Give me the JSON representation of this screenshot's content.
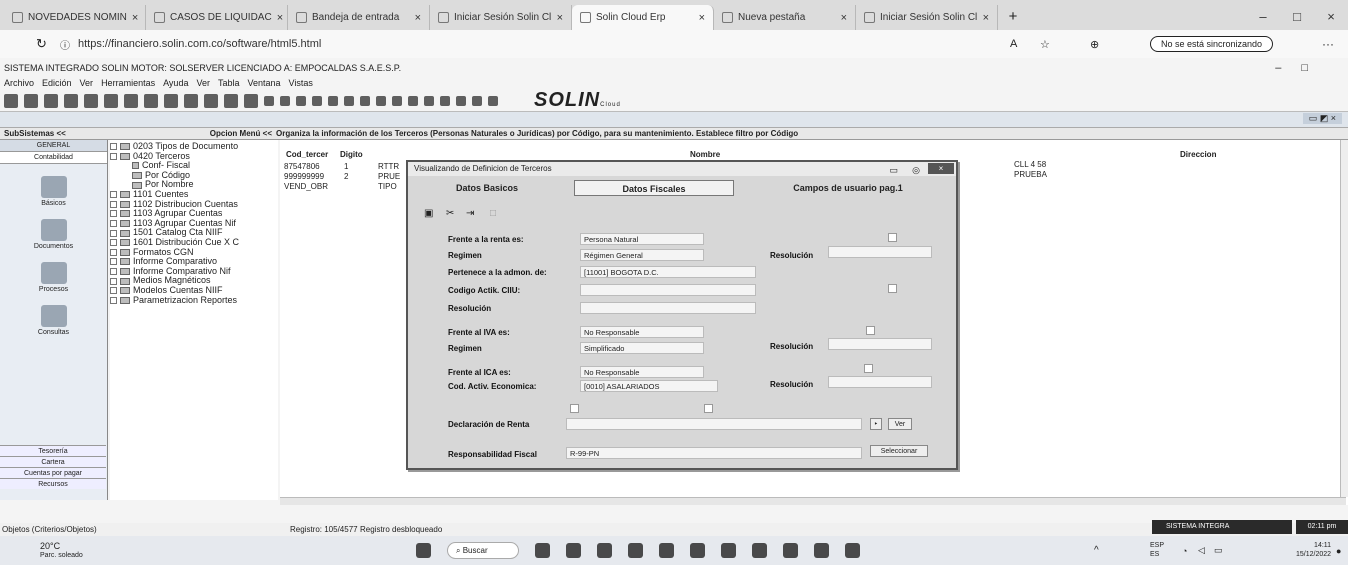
{
  "browser": {
    "tabs": [
      {
        "label": "NOVEDADES NOMIN"
      },
      {
        "label": "CASOS DE LIQUIDAC"
      },
      {
        "label": "Bandeja de entrada"
      },
      {
        "label": "Iniciar Sesión Solin Cl"
      },
      {
        "label": "Solin Cloud Erp"
      },
      {
        "label": "Nueva pestaña"
      },
      {
        "label": "Iniciar Sesión Solin Cl"
      }
    ],
    "url": "https://financiero.solin.com.co/software/html5.html",
    "sync_label": "No se está sincronizando"
  },
  "app": {
    "title": "SISTEMA INTEGRADO SOLIN MOTOR: SOLSERVER LICENCIADO A: EMPOCALDAS S.A.E.S.P.",
    "menu": [
      "Archivo",
      "Edición",
      "Ver",
      "Herramientas",
      "Ayuda",
      "Ver",
      "Tabla",
      "Ventana",
      "Vistas"
    ],
    "brand": "SOLIN",
    "brand_sub": "Cloud"
  },
  "header_row": {
    "subsistemas": "SubSistemas <<",
    "opcion_menu": "Opcion Menú <<",
    "info": "Organiza la información de los Terceros (Personas Naturales o Jurídicas) por Código, para su mantenimiento. Establece filtro por Código"
  },
  "sidebar": {
    "top_tabs": [
      "GENERAL",
      "Contabilidad"
    ],
    "items": [
      "Básicos",
      "Documentos",
      "Procesos",
      "Consultas"
    ],
    "bottom_tabs": [
      "Tesorería",
      "Cartera",
      "Cuentas por pagar",
      "Recursos"
    ]
  },
  "tree": {
    "items": [
      "0203 Tipos de Documento",
      "0420 Terceros",
      "Conf- Fiscal",
      "Por Código",
      "Por Nombre",
      "1101 Cuentes",
      "1102 Distribucion Cuentas",
      "1103 Agrupar Cuentas",
      "1103 Agrupar Cuentas Nif",
      "1501 Catalog Cta NIIF",
      "1601 Distribución Cue X C",
      "Formatos CGN",
      "Informe Comparativo",
      "Informe Comparativo Nif",
      "Medios Magnéticos",
      "Modelos Cuentas NIIF",
      "Parametrizacion Reportes"
    ]
  },
  "grid": {
    "headers": {
      "cod": "Cod_tercer",
      "digito": "Digito",
      "nombre": "Nombre",
      "direccion": "Direccion"
    },
    "rows": [
      {
        "cod": "87547806",
        "dig": "1",
        "nom": "RTTR",
        "dir": "CLL 4 58"
      },
      {
        "cod": "999999999",
        "dig": "2",
        "nom": "PRUE",
        "dir": "PRUEBA"
      },
      {
        "cod": "VEND_OBR",
        "dig": "",
        "nom": "TIPO",
        "dir": ""
      }
    ]
  },
  "dialog": {
    "title": "Visualizando de Definicion de Terceros",
    "tabs": [
      "Datos Basicos",
      "Datos Fiscales",
      "Campos de usuario pag.1"
    ],
    "fields": {
      "renta_label": "Frente a la renta es:",
      "renta_value": "Persona Natural",
      "regimen_label": "Regimen",
      "regimen_value": "Régimen General",
      "resolucion1": "Resolución",
      "pertenece_label": "Pertenece a la admon. de:",
      "pertenece_value": "[11001] BOGOTA D.C.",
      "codigo_ciiu_label": "Codigo Actik. CIIU:",
      "resolucion_label": "Resolución",
      "iva_label": "Frente al IVA es:",
      "iva_value": "No Responsable",
      "regimen2_label": "Regimen",
      "regimen2_value": "Simplificado",
      "resolucion2": "Resolución",
      "ica_label": "Frente al ICA es:",
      "ica_value": "No Responsable",
      "cod_econ_label": "Cod. Activ. Economica:",
      "cod_econ_value": "[0010] ASALARIADOS",
      "resolucion3": "Resolución",
      "declaracion_label": "Declaración de Renta",
      "ver_button": "Ver",
      "responsabilidad_label": "Responsabilidad Fiscal",
      "responsabilidad_value": "R-99-PN",
      "seleccionar_button": "Seleccionar"
    }
  },
  "status": {
    "objetos": "Objetos (Criterios/Objetos)",
    "registro": "Registro: 105/4577",
    "desbloqueado": "Registro desbloqueado"
  },
  "taskbar": {
    "weather_temp": "20°C",
    "weather_desc": "Parc. soleado",
    "search": "Buscar",
    "lang1": "ESP",
    "lang2": "ES",
    "time": "14:11",
    "date": "15/12/2022",
    "notif_app": "SISTEMA INTEGRA",
    "notif_time": "02:11 pm"
  }
}
